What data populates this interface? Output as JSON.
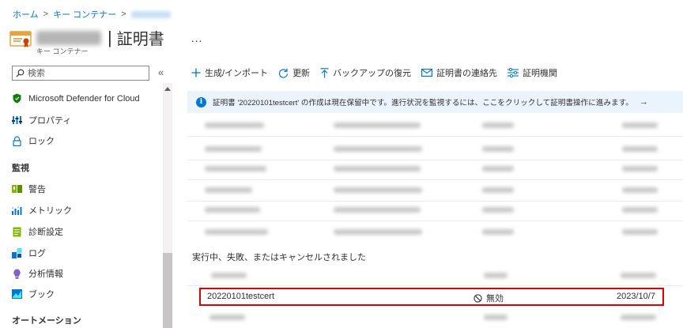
{
  "breadcrumb": {
    "home": "ホーム",
    "sep1": ">",
    "vaults": "キー コンテナー",
    "sep2": ">"
  },
  "header": {
    "title_sep": "|",
    "title": "証明書",
    "more": "...",
    "subtitle": "キー コンテナー"
  },
  "sidebar": {
    "search_placeholder": "検索",
    "collapse": "«",
    "items_top": [
      {
        "label": "Microsoft Defender for Cloud",
        "icon": "shield-icon"
      },
      {
        "label": "プロパティ",
        "icon": "properties-icon"
      },
      {
        "label": "ロック",
        "icon": "lock-icon"
      }
    ],
    "section_monitoring": "監視",
    "items_monitoring": [
      {
        "label": "警告",
        "icon": "alert-icon"
      },
      {
        "label": "メトリック",
        "icon": "metrics-icon"
      },
      {
        "label": "診断設定",
        "icon": "diagnostics-icon"
      },
      {
        "label": "ログ",
        "icon": "logs-icon"
      },
      {
        "label": "分析情報",
        "icon": "insights-icon"
      },
      {
        "label": "ブック",
        "icon": "workbook-icon"
      }
    ],
    "section_automation": "オートメーション"
  },
  "toolbar": {
    "generate": "生成/インポート",
    "refresh": "更新",
    "restore": "バックアップの復元",
    "contacts": "証明書の連絡先",
    "authorities": "証明機関"
  },
  "banner": {
    "message": "証明書 '20220101testcert' の作成は現在保留中です。進行状況を監視するには、ここをクリックして証明書操作に進みます。",
    "arrow": "→"
  },
  "section": {
    "in_progress_title": "実行中、失敗、またはキャンセルされました"
  },
  "highlighted_row": {
    "name": "20220101testcert",
    "status": "無効",
    "date": "2023/10/7"
  },
  "colors": {
    "accent": "#0078d4",
    "highlight_border": "#e00000",
    "banner_bg": "#ebf3fc"
  }
}
